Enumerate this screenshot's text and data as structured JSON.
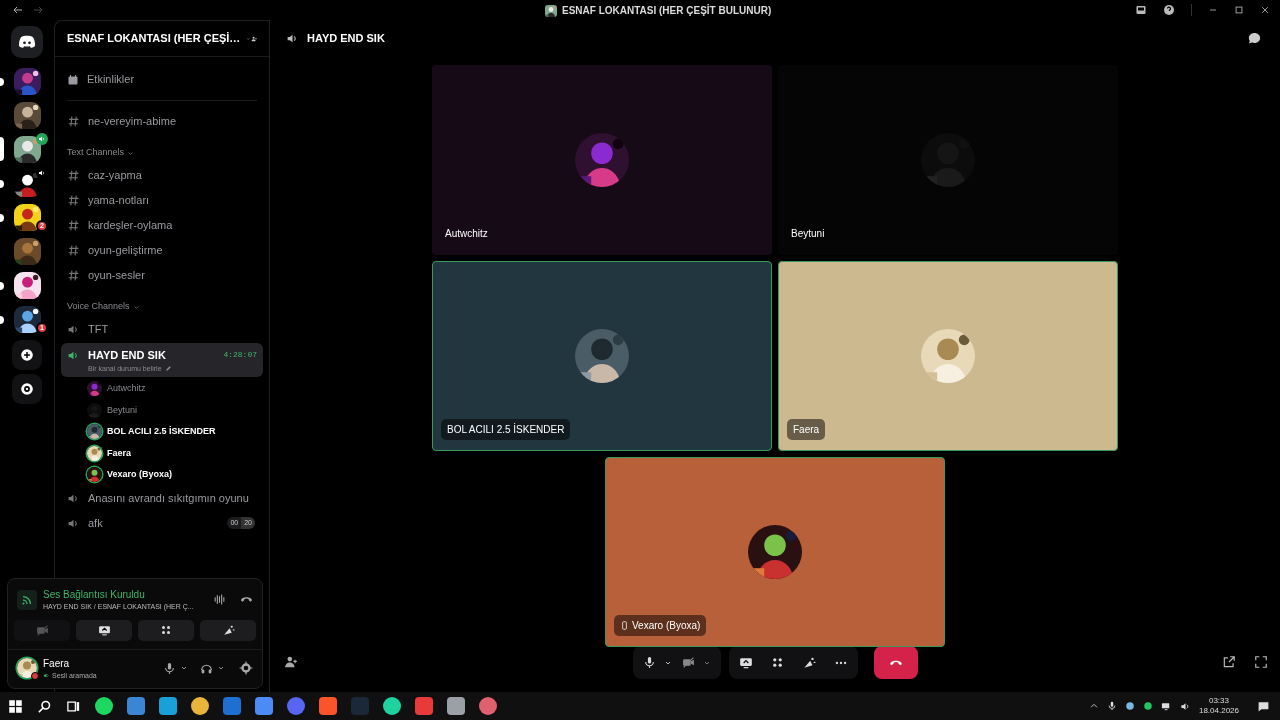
{
  "window": {
    "title": "ESNAF LOKANTASI (HER ÇEŞİT BULUNUR)"
  },
  "servers": [
    {
      "selected": false,
      "unread": true
    },
    {
      "selected": false,
      "unread": false
    },
    {
      "selected": true,
      "unread": false,
      "voice": true
    },
    {
      "selected": false,
      "unread": true,
      "voice": true
    },
    {
      "selected": false,
      "unread": true,
      "badge": "2"
    },
    {
      "selected": false,
      "unread": false
    },
    {
      "selected": false,
      "unread": true
    },
    {
      "selected": false,
      "unread": true,
      "badge": "1"
    }
  ],
  "sidebar": {
    "server_name": "ESNAF LOKANTASI (HER ÇEŞİ…",
    "events": "Etkinlikler",
    "top_channels": [
      {
        "name": "ne-vereyim-abime"
      }
    ],
    "categories": [
      {
        "title": "Text Channels",
        "kind": "text",
        "channels": [
          {
            "name": "caz-yapma"
          },
          {
            "name": "yama-notları"
          },
          {
            "name": "kardeşler-oylama"
          },
          {
            "name": "oyun-geliştirme"
          },
          {
            "name": "oyun-sesler"
          }
        ]
      },
      {
        "title": "Voice Channels",
        "kind": "voice",
        "channels": [
          {
            "name": "TFT",
            "selected": false
          },
          {
            "name": "HAYD END SIK",
            "selected": true,
            "timer": "4:28:07",
            "status": "Bir kanal durumu belirle",
            "members": [
              {
                "name": "Autwchitz",
                "speaking": false
              },
              {
                "name": "Beytuni",
                "speaking": false
              },
              {
                "name": "BOL ACILI 2.5 İSKENDER",
                "speaking": true
              },
              {
                "name": "Faera",
                "speaking": true
              },
              {
                "name": "Vexaro (Byoxa)",
                "speaking": true
              }
            ]
          },
          {
            "name": "Anasını avrandı sıkıtgımın oyunu",
            "selected": false
          },
          {
            "name": "afk",
            "selected": false,
            "counts": [
              "00",
              "20"
            ]
          }
        ]
      }
    ]
  },
  "voice_panel": {
    "title": "Ses Bağlantısı Kuruldu",
    "subtitle": "HAYD END SIK / ESNAF LOKANTASI (HER Ç...",
    "user": "Faera",
    "user_status": "Sesli aramada"
  },
  "main": {
    "channel": "HAYD END SIK",
    "tiles": [
      {
        "name": "Autwchitz",
        "speaking": false,
        "color": "#170a17"
      },
      {
        "name": "Beytuni",
        "speaking": false,
        "color": "#050505"
      },
      {
        "name": "BOL ACILI 2.5 İSKENDER",
        "speaking": true,
        "color": "#22363f"
      },
      {
        "name": "Faera",
        "speaking": true,
        "color": "#cdb98f"
      },
      {
        "name": "Vexaro (Byoxa)",
        "speaking": true,
        "color": "#b8603a",
        "mobile": true
      }
    ]
  },
  "taskbar": {
    "time": "03:33",
    "date": "18.04.2026"
  }
}
